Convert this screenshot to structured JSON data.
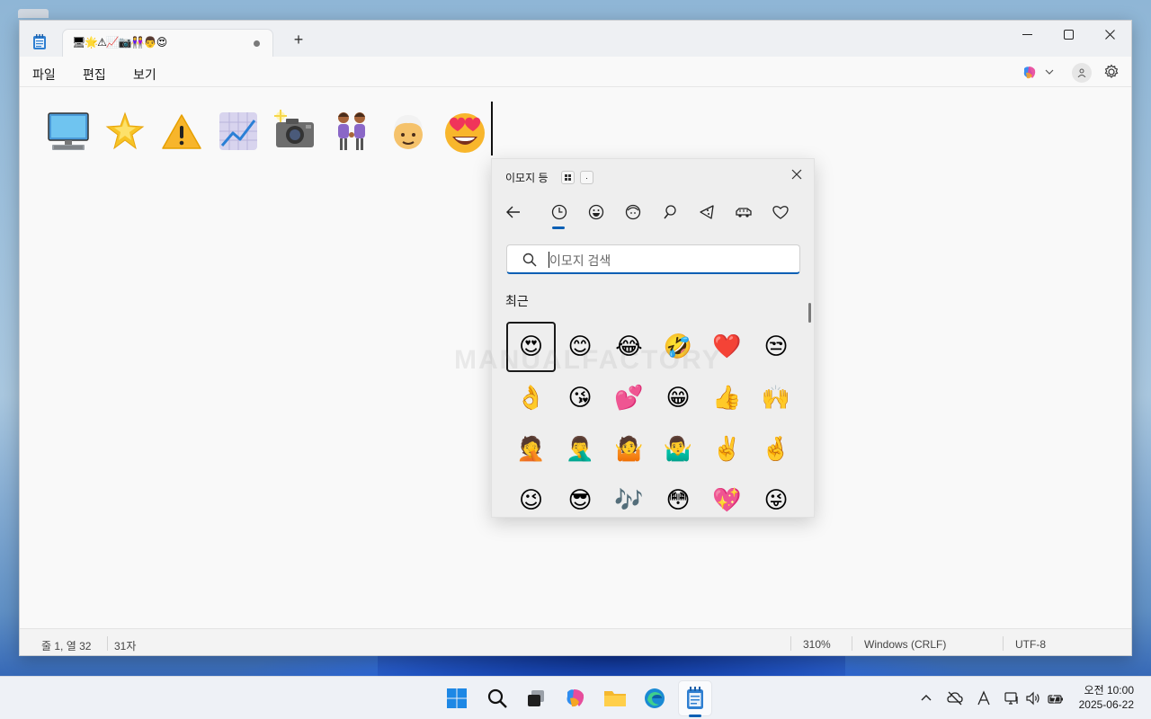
{
  "window": {
    "tab_title": "🖥🌟⚠📈📷👭👨😍",
    "new_tab": "+"
  },
  "menu": {
    "file": "파일",
    "edit": "편집",
    "view": "보기"
  },
  "editor": {
    "emojis": [
      "🖥️",
      "🌟",
      "⚠️",
      "📈",
      "📷",
      "👭",
      "👨",
      "😍"
    ]
  },
  "status": {
    "position": "줄 1, 열 32",
    "chars": "31자",
    "zoom": "310%",
    "line_ending": "Windows (CRLF)",
    "encoding": "UTF-8"
  },
  "emoji_panel": {
    "title": "이모지 등",
    "search_placeholder": "이모지 검색",
    "section": "최근",
    "emojis": [
      "😍",
      "😊",
      "😂",
      "🤣",
      "❤️",
      "😒",
      "👌",
      "😘",
      "💕",
      "😁",
      "👍",
      "🙌",
      "🤦",
      "🤦‍♂️",
      "🤷",
      "🤷‍♂️",
      "✌️",
      "🤞",
      "😉",
      "😎",
      "🎶",
      "😳",
      "💖",
      "😜"
    ],
    "selected_index": 0
  },
  "watermark": "MANUALFACTORY",
  "clock": {
    "period_time": "오전 10:00",
    "date": "2025-06-22"
  },
  "colors": {
    "accent": "#0a5fb4"
  }
}
